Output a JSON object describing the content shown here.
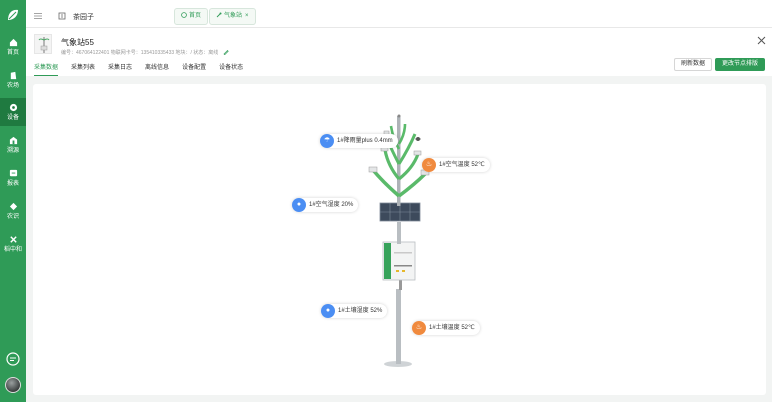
{
  "sidebar": {
    "items": [
      {
        "label": "首页",
        "icon": "home-icon"
      },
      {
        "label": "农场",
        "icon": "farm-icon"
      },
      {
        "label": "设备",
        "icon": "device-icon"
      },
      {
        "label": "溯源",
        "icon": "trace-icon"
      },
      {
        "label": "报表",
        "icon": "report-icon"
      },
      {
        "label": "农识",
        "icon": "knowledge-icon"
      },
      {
        "label": "稻中和",
        "icon": "carbon-icon"
      }
    ],
    "active_index": 2
  },
  "topbar": {
    "farm_name": "茶园子",
    "tabs": [
      {
        "label": "首页",
        "icon": "home-icon",
        "closable": false
      },
      {
        "label": "气象站",
        "icon": "station-icon",
        "closable": true,
        "close_glyph": "×"
      }
    ]
  },
  "device": {
    "title": "气象站55",
    "meta": "编号：467064122401   物联网卡号：135410335433   地块：/   状态：离线"
  },
  "subtabs": [
    "采集数据",
    "采集列表",
    "采集日志",
    "离线信息",
    "设备配置",
    "设备状态"
  ],
  "buttons": {
    "refresh": "刷新数据",
    "update_node": "更改节点排版"
  },
  "sensors": [
    {
      "label": "1#降雨量plus 0.4mm",
      "color": "blue",
      "glyph": "☂"
    },
    {
      "label": "1#空气温度 52℃",
      "color": "orange",
      "glyph": "♨"
    },
    {
      "label": "1#空气湿度 20%",
      "color": "blue",
      "glyph": "●"
    },
    {
      "label": "1#土壤湿度 52%",
      "color": "blue",
      "glyph": "●"
    },
    {
      "label": "1#土壤温度 52℃",
      "color": "orange",
      "glyph": "♨"
    }
  ],
  "colors": {
    "brand": "#2f9b57",
    "blue": "#4b8ef3",
    "orange": "#f08a3e"
  }
}
